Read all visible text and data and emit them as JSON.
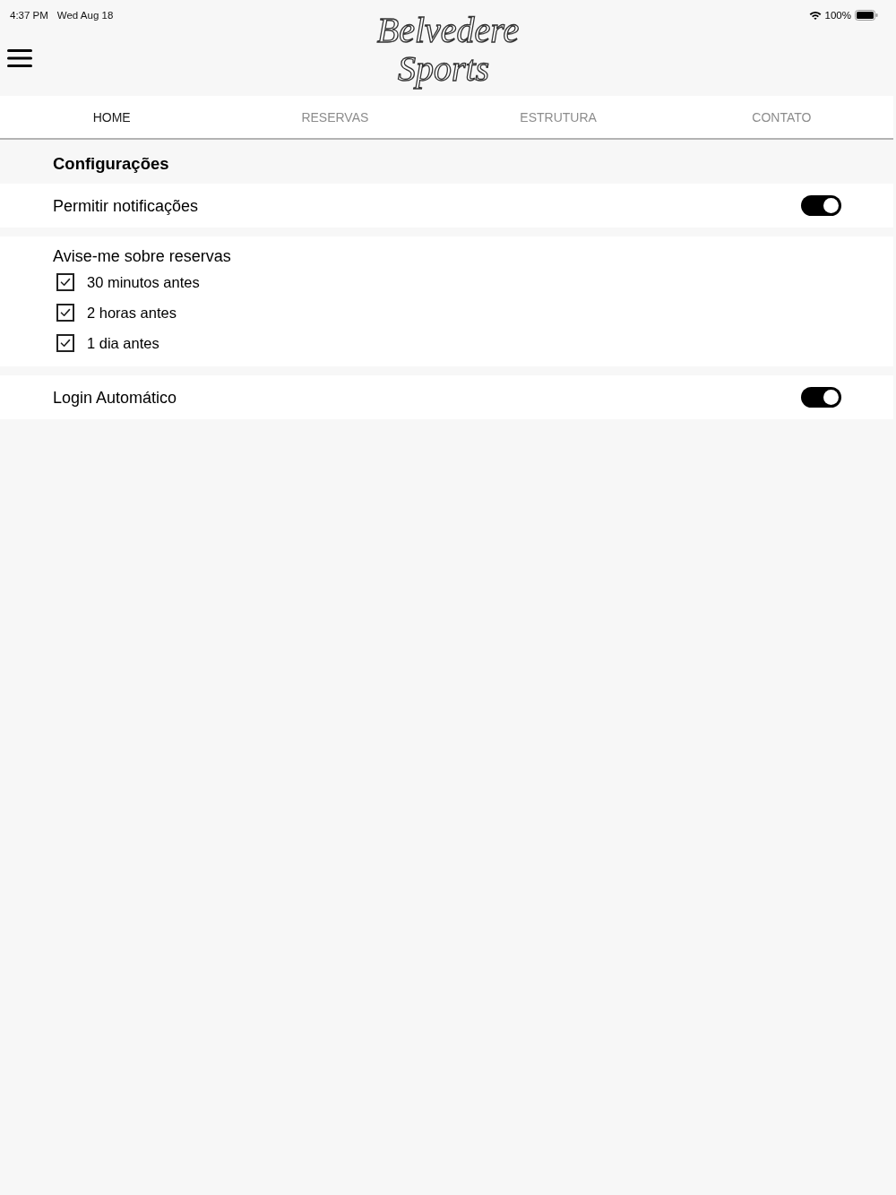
{
  "status_bar": {
    "time": "4:37 PM",
    "date": "Wed Aug 18",
    "battery_text": "100%"
  },
  "header": {
    "logo_lines": [
      "Belvedere",
      "Sports"
    ]
  },
  "tabs": [
    {
      "label": "HOME",
      "selected": true
    },
    {
      "label": "RESERVAS",
      "selected": false
    },
    {
      "label": "ESTRUTURA",
      "selected": false
    },
    {
      "label": "CONTATO",
      "selected": false
    }
  ],
  "settings": {
    "title": "Configurações",
    "groups": [
      {
        "kind": "toggle",
        "label": "Permitir notificações",
        "on": true
      },
      {
        "kind": "checklist",
        "label": "Avise-me sobre reservas",
        "options": [
          {
            "label": "30 minutos antes",
            "checked": true
          },
          {
            "label": "2 horas antes",
            "checked": true
          },
          {
            "label": "1 dia antes",
            "checked": true
          }
        ]
      },
      {
        "kind": "toggle",
        "label": "Login Automático",
        "on": true
      }
    ]
  }
}
